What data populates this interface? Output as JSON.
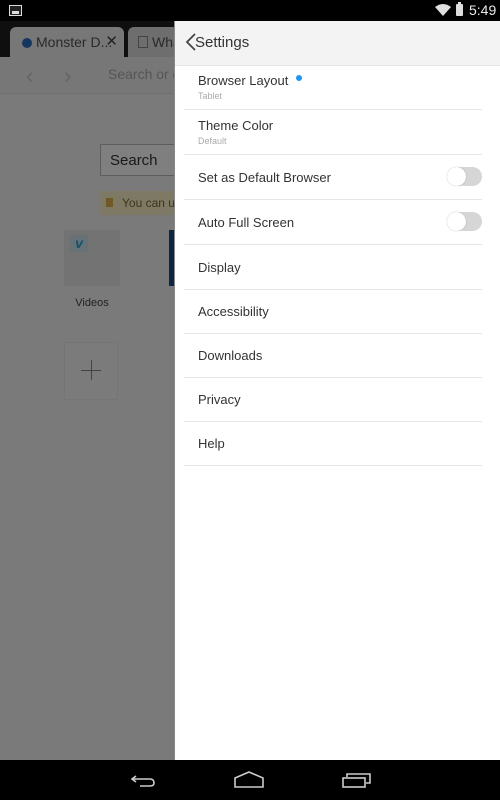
{
  "status_bar": {
    "time": "5:49",
    "icons": [
      "notification-image-icon",
      "wifi-icon",
      "battery-icon"
    ]
  },
  "browser": {
    "tabs": [
      {
        "title": "Monster D...",
        "icon": "download-icon",
        "active": true
      },
      {
        "title": "Wha",
        "icon": "page-icon",
        "active": false
      }
    ],
    "address_placeholder": "Search or e",
    "home_search_placeholder": "Search",
    "tip_text": "You can us",
    "speed_dial": [
      {
        "label": "Videos",
        "icon": "vimeo-icon"
      }
    ],
    "add_tile_icon": "plus-icon"
  },
  "settings": {
    "title": "Settings",
    "back_icon": "chevron-left-icon",
    "accent_color": "#2196F3",
    "items": [
      {
        "label": "Browser Layout",
        "sub": "Tablet",
        "badge": true
      },
      {
        "label": "Theme Color",
        "sub": "Default"
      },
      {
        "label": "Set as Default Browser",
        "toggle": false
      },
      {
        "label": "Auto Full Screen",
        "toggle": false
      },
      {
        "label": "Display"
      },
      {
        "label": "Accessibility"
      },
      {
        "label": "Downloads"
      },
      {
        "label": "Privacy"
      },
      {
        "label": "Help"
      }
    ]
  },
  "system_nav": {
    "buttons": [
      "back-icon",
      "home-icon",
      "recents-icon"
    ]
  }
}
